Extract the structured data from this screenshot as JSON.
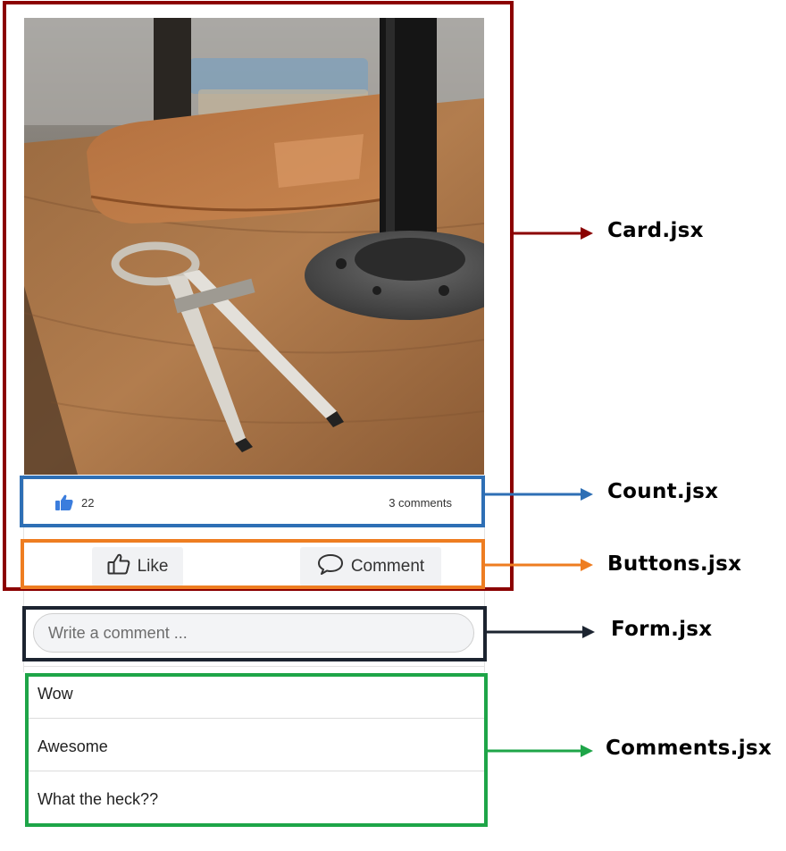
{
  "count": {
    "likes": "22",
    "comments": "3 comments"
  },
  "buttons": {
    "like_label": "Like",
    "comment_label": "Comment"
  },
  "form": {
    "placeholder": "Write a comment ..."
  },
  "comments": [
    "Wow",
    "Awesome",
    "What the heck??"
  ],
  "annotations": {
    "card": "Card.jsx",
    "count": "Count.jsx",
    "buttons": "Buttons.jsx",
    "form": "Form.jsx",
    "comments": "Comments.jsx"
  },
  "colors": {
    "card": "#8b0000",
    "count": "#2e6fb5",
    "buttons": "#ee7d21",
    "form": "#1c2430",
    "comments": "#1ea548",
    "like_icon": "#3b7ddd"
  },
  "icons": {
    "count_like": "thumbs-up-filled-icon",
    "like_button": "thumbs-up-outline-icon",
    "comment_button": "speech-bubble-icon"
  },
  "photo": {
    "subject": "drafting compass on wooden desk"
  }
}
